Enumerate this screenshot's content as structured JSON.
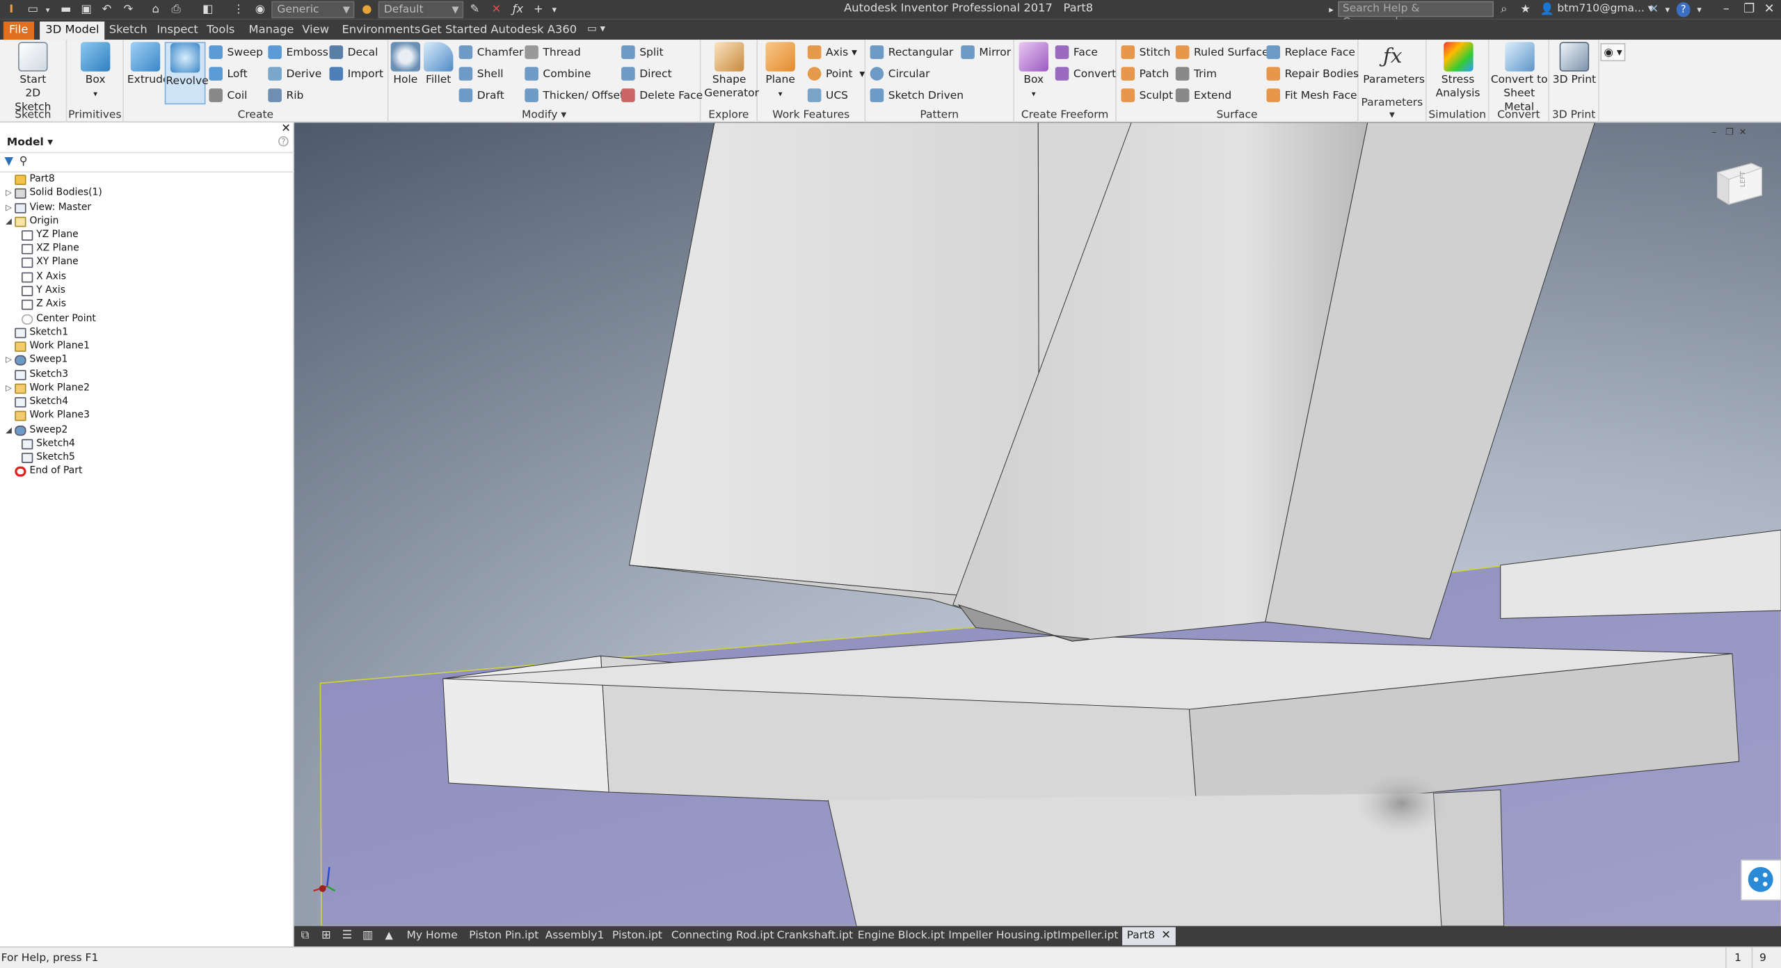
{
  "titlebar": {
    "material": "Generic",
    "appearance": "Default",
    "title": "Autodesk Inventor Professional 2017",
    "doc": "Part8",
    "search_placeholder": "Search Help & Commands...",
    "user": "btm710@gma..."
  },
  "tabs": [
    "File",
    "3D Model",
    "Sketch",
    "Inspect",
    "Tools",
    "Manage",
    "View",
    "Environments",
    "Get Started",
    "Autodesk A360"
  ],
  "ribbon": {
    "sketch": {
      "start": "Start",
      "sketch2d": "2D Sketch",
      "label": "Sketch"
    },
    "primitives": {
      "box": "Box",
      "label": "Primitives"
    },
    "create": {
      "extrude": "Extrude",
      "revolve": "Revolve",
      "sweep": "Sweep",
      "loft": "Loft",
      "coil": "Coil",
      "emboss": "Emboss",
      "derive": "Derive",
      "rib": "Rib",
      "decal": "Decal",
      "import": "Import",
      "label": "Create"
    },
    "modify": {
      "hole": "Hole",
      "fillet": "Fillet",
      "chamfer": "Chamfer",
      "shell": "Shell",
      "draft": "Draft",
      "thread": "Thread",
      "combine": "Combine",
      "thicken": "Thicken/ Offset",
      "split": "Split",
      "direct": "Direct",
      "delete_face": "Delete Face",
      "label": "Modify"
    },
    "explore": {
      "shape1": "Shape",
      "shape2": "Generator",
      "label": "Explore"
    },
    "work": {
      "plane": "Plane",
      "axis": "Axis",
      "point": "Point",
      "ucs": "UCS",
      "label": "Work Features"
    },
    "pattern": {
      "rect": "Rectangular",
      "circ": "Circular",
      "sketch_driven": "Sketch Driven",
      "mirror": "Mirror",
      "label": "Pattern"
    },
    "freeform": {
      "box": "Box",
      "face": "Face",
      "convert": "Convert",
      "label": "Create Freeform"
    },
    "surface": {
      "stitch": "Stitch",
      "patch": "Patch",
      "sculpt": "Sculpt",
      "ruled": "Ruled Surface",
      "trim": "Trim",
      "extend": "Extend",
      "replace": "Replace Face",
      "repair": "Repair Bodies",
      "fit_mesh": "Fit Mesh Face",
      "label": "Surface"
    },
    "params": {
      "btn": "Parameters",
      "label": "Parameters"
    },
    "sim": {
      "l1": "Stress",
      "l2": "Analysis",
      "label": "Simulation"
    },
    "convert": {
      "l1": "Convert to",
      "l2": "Sheet Metal",
      "label": "Convert"
    },
    "print": {
      "btn": "3D Print",
      "label": "3D Print"
    }
  },
  "browser": {
    "header": "Model",
    "items": [
      {
        "label": "Part8"
      },
      {
        "label": "Solid Bodies(1)"
      },
      {
        "label": "View: Master"
      },
      {
        "label": "Origin"
      },
      {
        "label": "YZ Plane"
      },
      {
        "label": "XZ Plane"
      },
      {
        "label": "XY Plane"
      },
      {
        "label": "X Axis"
      },
      {
        "label": "Y Axis"
      },
      {
        "label": "Z Axis"
      },
      {
        "label": "Center Point"
      },
      {
        "label": "Sketch1"
      },
      {
        "label": "Work Plane1"
      },
      {
        "label": "Sweep1"
      },
      {
        "label": "Sketch3"
      },
      {
        "label": "Work Plane2"
      },
      {
        "label": "Sketch4"
      },
      {
        "label": "Work Plane3"
      },
      {
        "label": "Sweep2"
      },
      {
        "label": "Sketch4"
      },
      {
        "label": "Sketch5"
      },
      {
        "label": "End of Part"
      }
    ]
  },
  "viewport": {
    "viewcube_face": "LEFT"
  },
  "doctabs": [
    "My Home",
    "Piston Pin.ipt",
    "Assembly1",
    "Piston.ipt",
    "Connecting Rod.ipt",
    "Crankshaft.ipt",
    "Engine Block.ipt",
    "Impeller Housing.ipt",
    "Impeller.ipt",
    "Part8"
  ],
  "status": {
    "help": "For Help, press F1",
    "n1": "1",
    "n2": "9"
  },
  "colors": {
    "accent_file": "#e07020",
    "ribbon_bg": "#f2f2f2",
    "titlebar": "#3c3c3c",
    "plane_blue": "#8f90c0"
  }
}
